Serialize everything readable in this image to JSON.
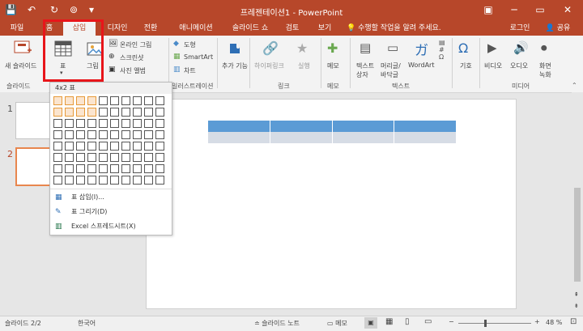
{
  "window": {
    "title": "프레젠테이션1 - PowerPoint"
  },
  "tabs": [
    "파일",
    "홈",
    "삽입",
    "디자인",
    "전환",
    "애니메이션",
    "슬라이드 쇼",
    "검토",
    "보기"
  ],
  "tell_me": "수행할 작업을 알려 주세요.",
  "account": {
    "signin": "로그인",
    "share": "공유"
  },
  "ribbon": {
    "new_slide": "새 슬라이드",
    "table": "표",
    "images": "그림",
    "online_pictures": "온라인 그림",
    "screenshot": "스크린샷",
    "photo_album": "사진 앨범",
    "shapes": "도형",
    "smartart": "SmartArt",
    "chart": "차트",
    "addins": "추가 기능",
    "hyperlink": "하이퍼링크",
    "action": "실행",
    "comment": "메모",
    "textbox_1": "텍스트",
    "textbox_2": "상자",
    "header_1": "머리글/",
    "header_2": "바닥글",
    "wordart": "WordArt",
    "symbols": "기호",
    "video": "비디오",
    "audio": "오디오",
    "screen_rec_1": "화면",
    "screen_rec_2": "녹화"
  },
  "groups": {
    "slides": "슬라이드",
    "illustrations": "일러스트레이션",
    "links": "링크",
    "comments": "메모",
    "text": "텍스트",
    "media": "미디어"
  },
  "table_menu": {
    "header": "4x2 표",
    "grid_cols": 10,
    "grid_rows": 8,
    "selected_cols": 4,
    "selected_rows": 2,
    "items": [
      "표 삽입(I)...",
      "표 그리기(D)",
      "Excel 스프레드시트(X)"
    ]
  },
  "slides_pane": {
    "numbers": [
      "1",
      "2"
    ]
  },
  "slide_table": {
    "cols": 4,
    "header_color": "#5b9bd5",
    "row_color": "#d6dce5"
  },
  "status": {
    "slide_count": "슬라이드 2/2",
    "language": "한국어",
    "notes": "슬라이드 노트",
    "comments": "메모",
    "zoom": "48 %"
  },
  "colors": {
    "accent": "#b7472a",
    "highlight": "#e8151a"
  }
}
